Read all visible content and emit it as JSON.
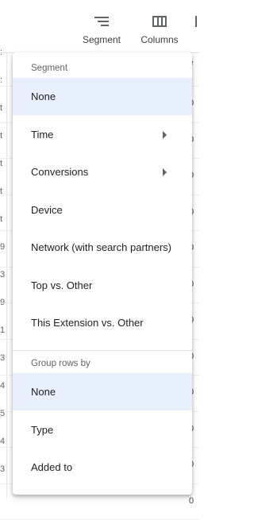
{
  "toolbar": {
    "segment_label": "Segment",
    "columns_label": "Columns"
  },
  "background": {
    "left_fragments": [
      ":",
      ":",
      "t",
      "t",
      "t",
      "t",
      "t",
      "9",
      "3",
      "9",
      "1",
      "3",
      "4",
      "5",
      "4",
      "3"
    ],
    "header_fragment_top": "e",
    "header_fragment_bottom": "t",
    "right_fragments": [
      "0",
      "0",
      "0",
      "0",
      "0",
      "0",
      "0",
      "0",
      "0",
      "0",
      "0",
      "0"
    ]
  },
  "menu": {
    "segment_header": "Segment",
    "segment_items": [
      {
        "label": "None",
        "selected": true,
        "submenu": false
      },
      {
        "label": "Time",
        "selected": false,
        "submenu": true
      },
      {
        "label": "Conversions",
        "selected": false,
        "submenu": true
      },
      {
        "label": "Device",
        "selected": false,
        "submenu": false
      },
      {
        "label": "Network (with search partners)",
        "selected": false,
        "submenu": false
      },
      {
        "label": "Top vs. Other",
        "selected": false,
        "submenu": false
      },
      {
        "label": "This Extension vs. Other",
        "selected": false,
        "submenu": false
      }
    ],
    "group_header": "Group rows by",
    "group_items": [
      {
        "label": "None",
        "selected": true,
        "submenu": false
      },
      {
        "label": "Type",
        "selected": false,
        "submenu": false
      },
      {
        "label": "Added to",
        "selected": false,
        "submenu": false
      }
    ]
  }
}
